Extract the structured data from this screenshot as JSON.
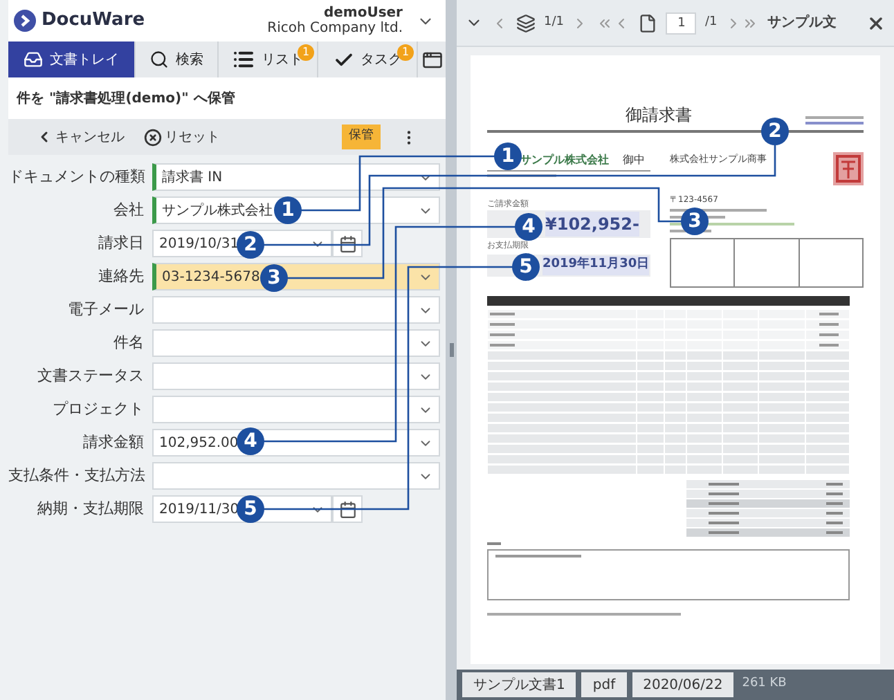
{
  "header": {
    "logo": "DocuWare",
    "user": "demoUser",
    "company": "Ricoh Company ltd."
  },
  "tabs": [
    {
      "label": "文書トレイ",
      "kind": "tray",
      "selected": true
    },
    {
      "label": "検索",
      "kind": "search",
      "selected": false
    },
    {
      "label": "リスト",
      "kind": "list",
      "selected": false,
      "badge": "1"
    },
    {
      "label": "タスク",
      "kind": "tasks",
      "selected": false,
      "badge": "1"
    }
  ],
  "store_title": "件を \"請求書処理(demo)\" へ保管",
  "actions": {
    "cancel": "キャンセル",
    "reset": "リセット",
    "store": "保管"
  },
  "fields": [
    {
      "label": "ドキュメントの種類",
      "value": "請求書 IN",
      "kind": "select",
      "marked": true,
      "highlighted": false
    },
    {
      "label": "会社",
      "value": "サンプル株式会社",
      "kind": "select",
      "marked": true,
      "highlighted": false
    },
    {
      "label": "請求日",
      "value": "2019/10/31",
      "kind": "date",
      "marked": false,
      "highlighted": false
    },
    {
      "label": "連絡先",
      "value": "03-1234-5678",
      "kind": "select",
      "marked": true,
      "highlighted": true
    },
    {
      "label": "電子メール",
      "kind": "select",
      "marked": false,
      "highlighted": false
    },
    {
      "label": "件名",
      "kind": "select",
      "marked": false,
      "highlighted": false
    },
    {
      "label": "文書ステータス",
      "kind": "select",
      "marked": false,
      "highlighted": false
    },
    {
      "label": "プロジェクト",
      "kind": "select",
      "marked": false,
      "highlighted": false
    },
    {
      "label": "請求金額",
      "value": "102,952.00",
      "kind": "select",
      "marked": false,
      "highlighted": false
    },
    {
      "label": "支払条件・支払方法",
      "kind": "select",
      "marked": false,
      "highlighted": false
    },
    {
      "label": "納期・支払期限",
      "value": "2019/11/30",
      "kind": "date",
      "marked": false,
      "highlighted": false
    }
  ],
  "viewer": {
    "bundle_counter": "1/1",
    "page_input": "1",
    "page_total": "/1",
    "document_name": "サンプル文"
  },
  "document": {
    "title": "御請求書",
    "recipient": "サンプル株式会社",
    "honorific": "御中",
    "sender": "株式会社サンプル商事",
    "postal_code": "〒123-4567",
    "amount_label": "ご請求金額",
    "amount": "¥102,952-",
    "due_label": "お支払期限",
    "due_date": "2019年11月30日"
  },
  "callouts": [
    {
      "form_number": "1",
      "document_number": "1"
    },
    {
      "form_number": "2",
      "document_number": "2"
    },
    {
      "form_number": "3",
      "document_number": "3"
    },
    {
      "form_number": "4",
      "document_number": "4"
    },
    {
      "form_number": "5",
      "document_number": "5"
    }
  ],
  "status_bar": {
    "chips": [
      "サンプル文書1",
      "pdf",
      "2020/06/22"
    ],
    "size": "261 KB"
  }
}
